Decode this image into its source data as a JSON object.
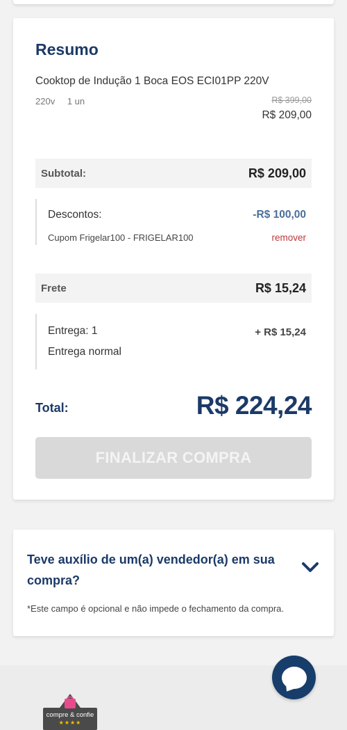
{
  "summary": {
    "title": "Resumo",
    "product": {
      "name": "Cooktop de Indução 1 Boca EOS ECI01PP 220V",
      "voltage": "220v",
      "quantity": "1 un",
      "old_price": "R$ 399,00",
      "price": "R$ 209,00"
    },
    "subtotal": {
      "label": "Subtotal:",
      "value": "R$ 209,00"
    },
    "discounts": {
      "label": "Descontos:",
      "value": "-R$ 100,00",
      "coupon": "Cupom Frigelar100 - FRIGELAR100",
      "remove_label": "remover"
    },
    "frete": {
      "label": "Frete",
      "value": "R$ 15,24"
    },
    "delivery": {
      "label": "Entrega: 1",
      "type": "Entrega normal",
      "value": "+ R$ 15,24"
    },
    "total": {
      "label": "Total:",
      "value": "R$ 224,24"
    },
    "finish_button": "FINALIZAR COMPRA"
  },
  "seller": {
    "question": "Teve auxílio de um(a) vendedor(a) em sua compra?",
    "note": "*Este campo é opcional e não impede o fechamento da compra."
  },
  "badge": {
    "text": "compre & confie",
    "stars": "★★★★"
  },
  "colors": {
    "brand_blue": "#1b3a68",
    "discount_blue": "#4a6e9a",
    "remove_red": "#b83a3a",
    "disabled_button": "#d9d9d9",
    "chat_button": "#173d6b"
  },
  "icons": [
    "chevron-down-icon",
    "chat-icon",
    "shopping-bag-icon"
  ]
}
